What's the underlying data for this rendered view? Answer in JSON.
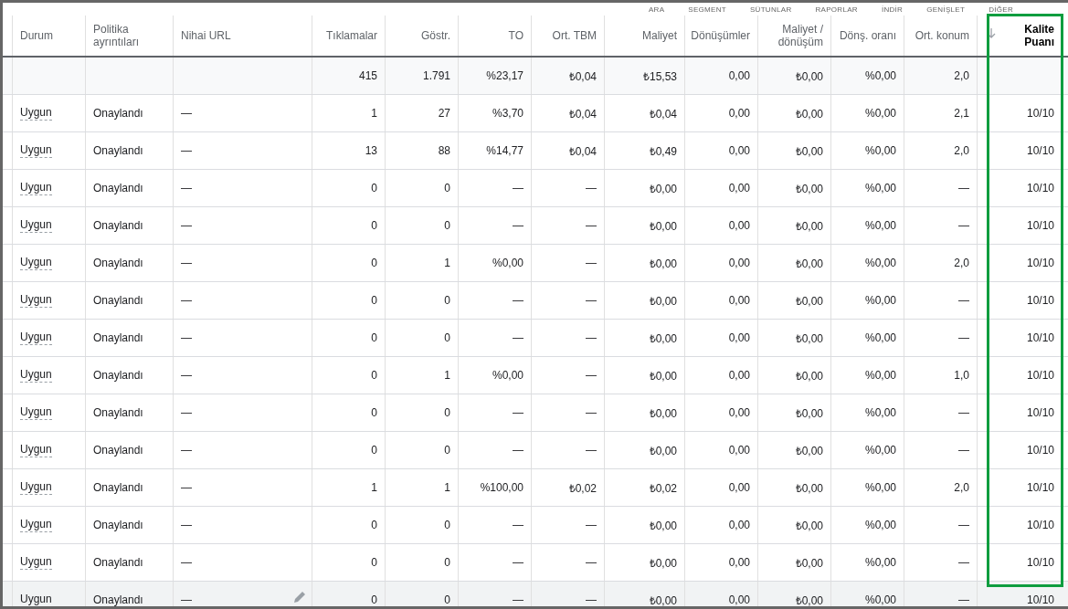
{
  "toolbar": [
    "ARA",
    "SEGMENT",
    "SÜTUNLAR",
    "RAPORLAR",
    "İNDİR",
    "GENİŞLET",
    "DİĞER"
  ],
  "columns": [
    {
      "label": "Durum",
      "kind": "text",
      "highlighted": false,
      "sorted": false
    },
    {
      "label": "Politika ayrıntıları",
      "kind": "text",
      "highlighted": false,
      "sorted": false
    },
    {
      "label": "Nihai URL",
      "kind": "text",
      "highlighted": false,
      "sorted": false
    },
    {
      "label": "Tıklamalar",
      "kind": "number",
      "total": "415",
      "highlighted": false,
      "sorted": false
    },
    {
      "label": "Göstr.",
      "kind": "number",
      "total": "1.791",
      "highlighted": false,
      "sorted": false
    },
    {
      "label": "TO",
      "kind": "number",
      "total": "%23,17",
      "highlighted": false,
      "sorted": false
    },
    {
      "label": "Ort. TBM",
      "kind": "number",
      "total": "₺0,04",
      "highlighted": false,
      "sorted": false
    },
    {
      "label": "Maliyet",
      "kind": "number",
      "total": "₺15,53",
      "highlighted": false,
      "sorted": false
    },
    {
      "label": "Dönüşümler",
      "kind": "number",
      "total": "0,00",
      "highlighted": false,
      "sorted": false
    },
    {
      "label": "Maliyet / dönüşüm",
      "kind": "number",
      "total": "₺0,00",
      "highlighted": false,
      "sorted": false
    },
    {
      "label": "Dönş. oranı",
      "kind": "number",
      "total": "%0,00",
      "highlighted": false,
      "sorted": false
    },
    {
      "label": "Ort. konum",
      "kind": "number",
      "total": "2,0",
      "highlighted": false,
      "sorted": false
    },
    {
      "label": "Kalite Puanı",
      "kind": "number",
      "highlighted": true,
      "sorted": true
    }
  ],
  "rows": [
    {
      "hovered": false,
      "cells": [
        "Uygun",
        "Onaylandı",
        "—",
        "1",
        "27",
        "%3,70",
        "₺0,04",
        "₺0,04",
        "0,00",
        "₺0,00",
        "%0,00",
        "2,1",
        "10/10"
      ]
    },
    {
      "hovered": false,
      "cells": [
        "Uygun",
        "Onaylandı",
        "—",
        "13",
        "88",
        "%14,77",
        "₺0,04",
        "₺0,49",
        "0,00",
        "₺0,00",
        "%0,00",
        "2,0",
        "10/10"
      ]
    },
    {
      "hovered": false,
      "cells": [
        "Uygun",
        "Onaylandı",
        "—",
        "0",
        "0",
        "—",
        "—",
        "₺0,00",
        "0,00",
        "₺0,00",
        "%0,00",
        "—",
        "10/10"
      ]
    },
    {
      "hovered": false,
      "cells": [
        "Uygun",
        "Onaylandı",
        "—",
        "0",
        "0",
        "—",
        "—",
        "₺0,00",
        "0,00",
        "₺0,00",
        "%0,00",
        "—",
        "10/10"
      ]
    },
    {
      "hovered": false,
      "cells": [
        "Uygun",
        "Onaylandı",
        "—",
        "0",
        "1",
        "%0,00",
        "—",
        "₺0,00",
        "0,00",
        "₺0,00",
        "%0,00",
        "2,0",
        "10/10"
      ]
    },
    {
      "hovered": false,
      "cells": [
        "Uygun",
        "Onaylandı",
        "—",
        "0",
        "0",
        "—",
        "—",
        "₺0,00",
        "0,00",
        "₺0,00",
        "%0,00",
        "—",
        "10/10"
      ]
    },
    {
      "hovered": false,
      "cells": [
        "Uygun",
        "Onaylandı",
        "—",
        "0",
        "0",
        "—",
        "—",
        "₺0,00",
        "0,00",
        "₺0,00",
        "%0,00",
        "—",
        "10/10"
      ]
    },
    {
      "hovered": false,
      "cells": [
        "Uygun",
        "Onaylandı",
        "—",
        "0",
        "1",
        "%0,00",
        "—",
        "₺0,00",
        "0,00",
        "₺0,00",
        "%0,00",
        "1,0",
        "10/10"
      ]
    },
    {
      "hovered": false,
      "cells": [
        "Uygun",
        "Onaylandı",
        "—",
        "0",
        "0",
        "—",
        "—",
        "₺0,00",
        "0,00",
        "₺0,00",
        "%0,00",
        "—",
        "10/10"
      ]
    },
    {
      "hovered": false,
      "cells": [
        "Uygun",
        "Onaylandı",
        "—",
        "0",
        "0",
        "—",
        "—",
        "₺0,00",
        "0,00",
        "₺0,00",
        "%0,00",
        "—",
        "10/10"
      ]
    },
    {
      "hovered": false,
      "cells": [
        "Uygun",
        "Onaylandı",
        "—",
        "1",
        "1",
        "%100,00",
        "₺0,02",
        "₺0,02",
        "0,00",
        "₺0,00",
        "%0,00",
        "2,0",
        "10/10"
      ]
    },
    {
      "hovered": false,
      "cells": [
        "Uygun",
        "Onaylandı",
        "—",
        "0",
        "0",
        "—",
        "—",
        "₺0,00",
        "0,00",
        "₺0,00",
        "%0,00",
        "—",
        "10/10"
      ]
    },
    {
      "hovered": false,
      "cells": [
        "Uygun",
        "Onaylandı",
        "—",
        "0",
        "0",
        "—",
        "—",
        "₺0,00",
        "0,00",
        "₺0,00",
        "%0,00",
        "—",
        "10/10"
      ]
    },
    {
      "hovered": true,
      "cells": [
        "Uygun",
        "Onaylandı",
        "—",
        "0",
        "0",
        "—",
        "—",
        "₺0,00",
        "0,00",
        "₺0,00",
        "%0,00",
        "—",
        "10/10"
      ]
    }
  ]
}
